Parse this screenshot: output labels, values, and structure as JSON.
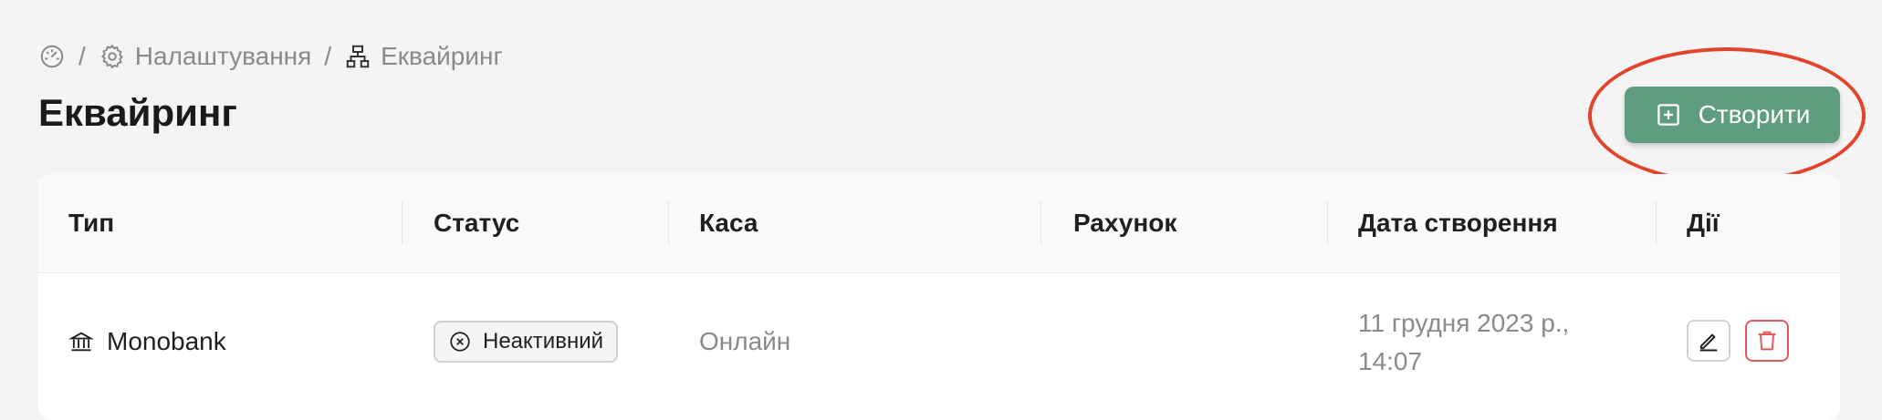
{
  "breadcrumb": {
    "home_icon": "dashboard-gauge-icon",
    "separator": "/",
    "settings_label": "Налаштування",
    "settings_icon": "gear-icon",
    "current_label": "Еквайринг",
    "current_icon": "hierarchy-icon"
  },
  "page": {
    "title": "Еквайринг"
  },
  "actions": {
    "create_label": "Створити",
    "create_icon": "plus-square-icon"
  },
  "table": {
    "columns": [
      "Тип",
      "Статус",
      "Каса",
      "Рахунок",
      "Дата створення",
      "Дії"
    ],
    "rows": [
      {
        "type": "Monobank",
        "type_icon": "bank-icon",
        "status": "Неактивний",
        "status_icon": "circle-x-icon",
        "cashbox": "Онлайн",
        "account": "",
        "created_line1": "11 грудня 2023 р.,",
        "created_line2": "14:07",
        "edit_icon": "pencil-icon",
        "delete_icon": "trash-icon"
      }
    ]
  },
  "colors": {
    "primary_button": "#5f9c80",
    "highlight_ring": "#e2432a",
    "danger": "#e05a5a",
    "background": "#f4f4f4"
  }
}
